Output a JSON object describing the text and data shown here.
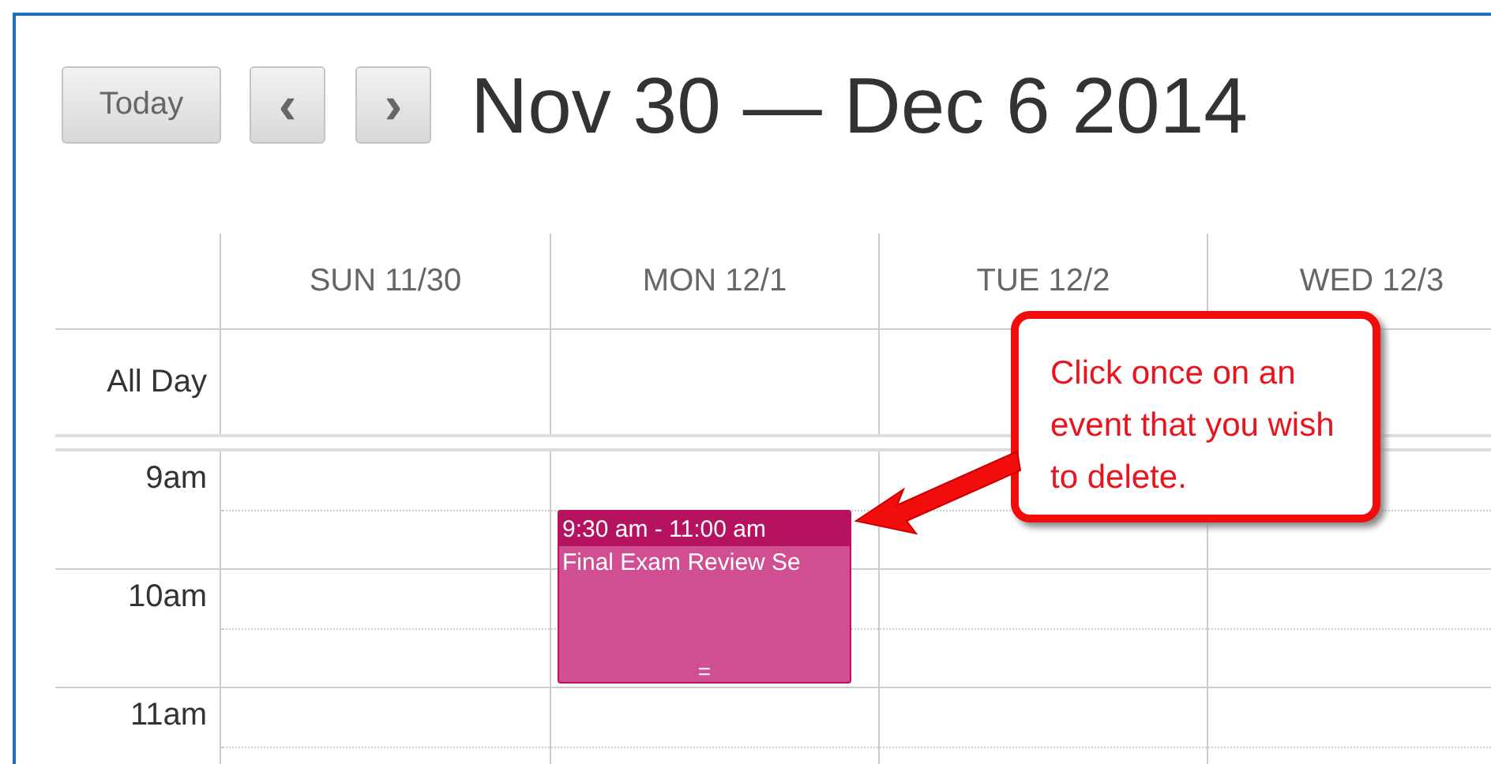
{
  "toolbar": {
    "today_button": "Today",
    "prev_button": "‹",
    "next_button": "›",
    "title": "Nov 30 — Dec 6 2014"
  },
  "days": [
    {
      "label": "SUN 11/30"
    },
    {
      "label": "MON 12/1"
    },
    {
      "label": "TUE 12/2"
    },
    {
      "label": "WED 12/3"
    }
  ],
  "all_day_label": "All Day",
  "hours": [
    {
      "label": "9am"
    },
    {
      "label": "10am"
    },
    {
      "label": "11am"
    }
  ],
  "events": [
    {
      "time": "9:30 am - 11:00 am",
      "title": "Final Exam Review Se",
      "resize_handle": "=",
      "color": "#b5135f"
    }
  ],
  "callout": {
    "text": "Click once on an event that you wish to delete."
  }
}
